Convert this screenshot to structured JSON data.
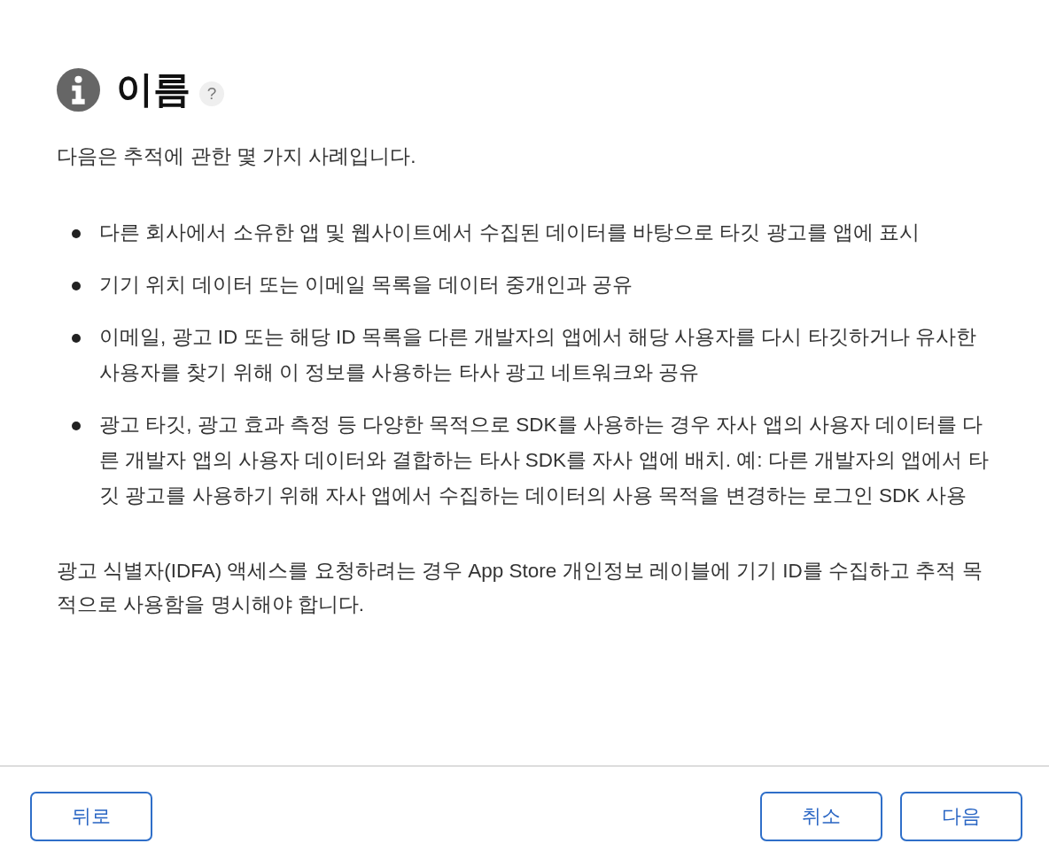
{
  "header": {
    "title": "이름",
    "help_label": "?"
  },
  "intro": "다음은 추적에 관한 몇 가지 사례입니다.",
  "examples": [
    "다른 회사에서 소유한 앱 및 웹사이트에서 수집된 데이터를 바탕으로 타깃 광고를 앱에 표시",
    "기기 위치 데이터 또는 이메일 목록을 데이터 중개인과 공유",
    "이메일, 광고 ID 또는 해당 ID 목록을 다른 개발자의 앱에서 해당 사용자를 다시 타깃하거나 유사한 사용자를 찾기 위해 이 정보를 사용하는 타사 광고 네트워크와 공유",
    "광고 타깃, 광고 효과 측정 등 다양한 목적으로 SDK를 사용하는 경우 자사 앱의 사용자 데이터를 다른 개발자 앱의 사용자 데이터와 결합하는 타사 SDK를 자사 앱에 배치. 예: 다른 개발자의 앱에서 타깃 광고를 사용하기 위해 자사 앱에서 수집하는 데이터의 사용 목적을 변경하는 로그인 SDK 사용"
  ],
  "note": "광고 식별자(IDFA) 액세스를 요청하려는 경우 App Store 개인정보 레이블에 기기 ID를 수집하고 추적 목적으로 사용함을 명시해야 합니다.",
  "footer": {
    "left_buttons": [
      {
        "label": "뒤로"
      }
    ],
    "right_buttons": [
      {
        "label": "취소"
      },
      {
        "label": "다음"
      }
    ]
  }
}
